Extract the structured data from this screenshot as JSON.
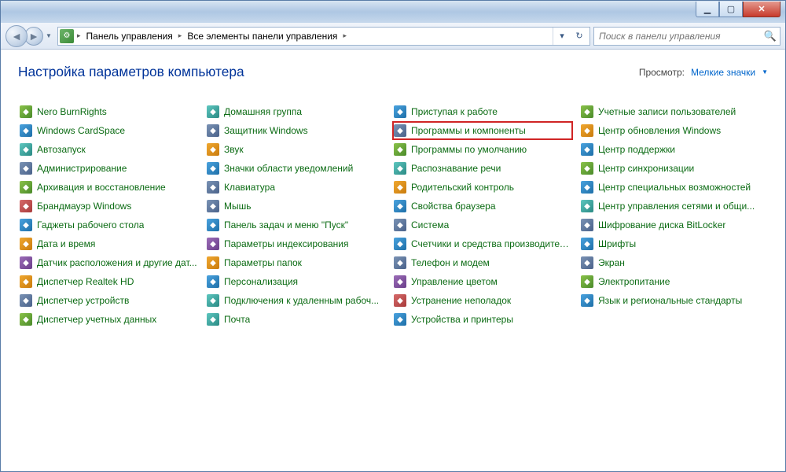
{
  "window": {
    "minimize": "▁",
    "maximize": "▢",
    "close": "✕"
  },
  "breadcrumb": {
    "root": "Панель управления",
    "sub": "Все элементы панели управления"
  },
  "search": {
    "placeholder": "Поиск в панели управления"
  },
  "header": {
    "title": "Настройка параметров компьютера",
    "view_label": "Просмотр:",
    "view_value": "Мелкие значки"
  },
  "items": [
    {
      "label": "Nero BurnRights",
      "icon": "c1",
      "hl": false
    },
    {
      "label": "Windows CardSpace",
      "icon": "c2",
      "hl": false
    },
    {
      "label": "Автозапуск",
      "icon": "c6",
      "hl": false
    },
    {
      "label": "Администрирование",
      "icon": "c8",
      "hl": false
    },
    {
      "label": "Архивация и восстановление",
      "icon": "c1",
      "hl": false
    },
    {
      "label": "Брандмауэр Windows",
      "icon": "c5",
      "hl": false
    },
    {
      "label": "Гаджеты рабочего стола",
      "icon": "c2",
      "hl": false
    },
    {
      "label": "Дата и время",
      "icon": "c3",
      "hl": false
    },
    {
      "label": "Датчик расположения и другие дат...",
      "icon": "c4",
      "hl": false
    },
    {
      "label": "Диспетчер Realtek HD",
      "icon": "c3",
      "hl": false
    },
    {
      "label": "Диспетчер устройств",
      "icon": "c8",
      "hl": false
    },
    {
      "label": "Диспетчер учетных данных",
      "icon": "c1",
      "hl": false
    },
    {
      "label": "Домашняя группа",
      "icon": "c6",
      "hl": false
    },
    {
      "label": "Защитник Windows",
      "icon": "c8",
      "hl": false
    },
    {
      "label": "Звук",
      "icon": "c3",
      "hl": false
    },
    {
      "label": "Значки области уведомлений",
      "icon": "c2",
      "hl": false
    },
    {
      "label": "Клавиатура",
      "icon": "c8",
      "hl": false
    },
    {
      "label": "Мышь",
      "icon": "c8",
      "hl": false
    },
    {
      "label": "Панель задач и меню \"Пуск\"",
      "icon": "c2",
      "hl": false
    },
    {
      "label": "Параметры индексирования",
      "icon": "c4",
      "hl": false
    },
    {
      "label": "Параметры папок",
      "icon": "c3",
      "hl": false
    },
    {
      "label": "Персонализация",
      "icon": "c2",
      "hl": false
    },
    {
      "label": "Подключения к удаленным рабоч...",
      "icon": "c6",
      "hl": false
    },
    {
      "label": "Почта",
      "icon": "c6",
      "hl": false
    },
    {
      "label": "Приступая к работе",
      "icon": "c2",
      "hl": false
    },
    {
      "label": "Программы и компоненты",
      "icon": "c8",
      "hl": true
    },
    {
      "label": "Программы по умолчанию",
      "icon": "c1",
      "hl": false
    },
    {
      "label": "Распознавание речи",
      "icon": "c6",
      "hl": false
    },
    {
      "label": "Родительский контроль",
      "icon": "c3",
      "hl": false
    },
    {
      "label": "Свойства браузера",
      "icon": "c2",
      "hl": false
    },
    {
      "label": "Система",
      "icon": "c8",
      "hl": false
    },
    {
      "label": "Счетчики и средства производител...",
      "icon": "c2",
      "hl": false
    },
    {
      "label": "Телефон и модем",
      "icon": "c8",
      "hl": false
    },
    {
      "label": "Управление цветом",
      "icon": "c4",
      "hl": false
    },
    {
      "label": "Устранение неполадок",
      "icon": "c5",
      "hl": false
    },
    {
      "label": "Устройства и принтеры",
      "icon": "c2",
      "hl": false
    },
    {
      "label": "Учетные записи пользователей",
      "icon": "c1",
      "hl": false
    },
    {
      "label": "Центр обновления Windows",
      "icon": "c3",
      "hl": false
    },
    {
      "label": "Центр поддержки",
      "icon": "c2",
      "hl": false
    },
    {
      "label": "Центр синхронизации",
      "icon": "c1",
      "hl": false
    },
    {
      "label": "Центр специальных возможностей",
      "icon": "c2",
      "hl": false
    },
    {
      "label": "Центр управления сетями и общи...",
      "icon": "c6",
      "hl": false
    },
    {
      "label": "Шифрование диска BitLocker",
      "icon": "c8",
      "hl": false
    },
    {
      "label": "Шрифты",
      "icon": "c2",
      "hl": false
    },
    {
      "label": "Экран",
      "icon": "c8",
      "hl": false
    },
    {
      "label": "Электропитание",
      "icon": "c1",
      "hl": false
    },
    {
      "label": "Язык и региональные стандарты",
      "icon": "c2",
      "hl": false
    }
  ]
}
